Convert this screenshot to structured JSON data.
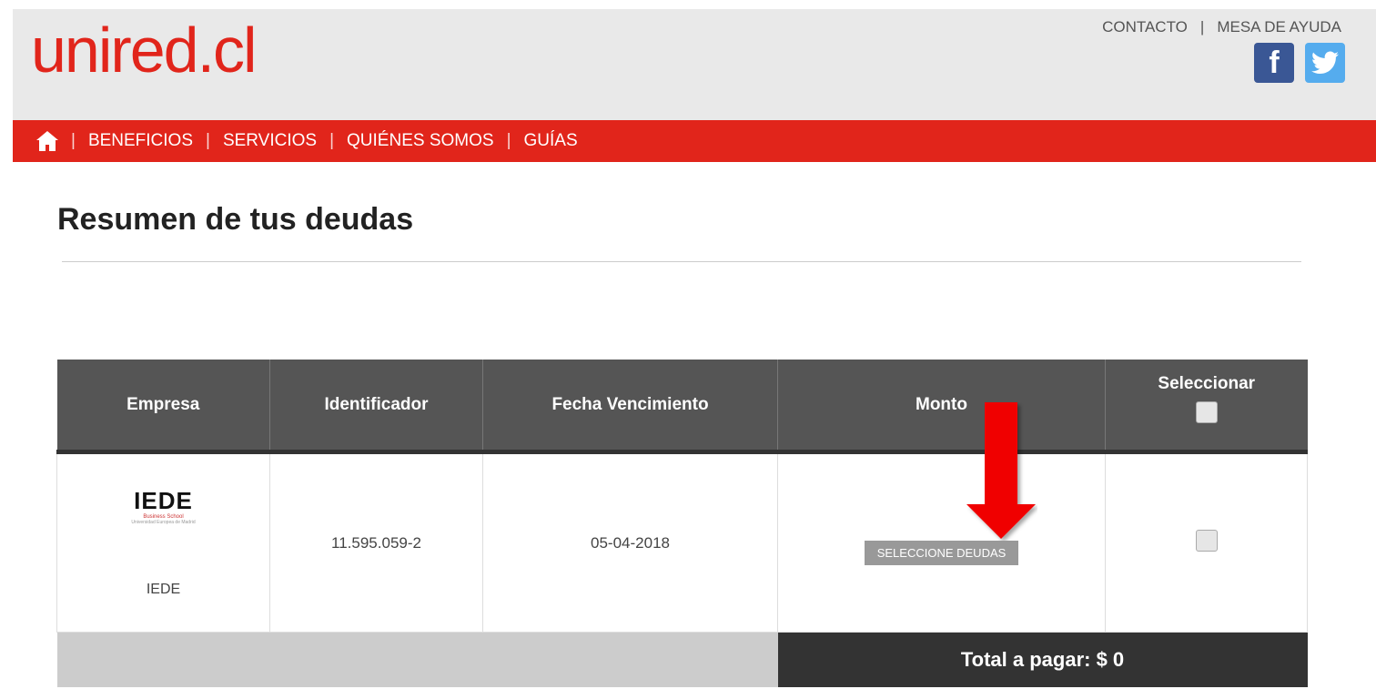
{
  "header": {
    "logo": "unired.cl",
    "links": [
      "CONTACTO",
      "MESA DE AYUDA"
    ],
    "social": [
      "facebook-icon",
      "twitter-icon"
    ]
  },
  "nav": {
    "items": [
      "BENEFICIOS",
      "SERVICIOS",
      "QUIÉNES SOMOS",
      "GUÍAS"
    ]
  },
  "page": {
    "title": "Resumen de tus deudas"
  },
  "table": {
    "headers": [
      "Empresa",
      "Identificador",
      "Fecha Vencimiento",
      "Monto",
      "Seleccionar"
    ],
    "row": {
      "logo_text": "IEDE",
      "logo_sub1": "Business School",
      "logo_sub2": "Universidad Europea de Madrid",
      "empresa": "IEDE",
      "identificador": "11.595.059-2",
      "fecha": "05-04-2018",
      "monto_button": "SELECCIONE DEUDAS"
    },
    "total": "Total a pagar: $ 0"
  },
  "colors": {
    "brand_red": "#e1251b",
    "header_gray": "#e9e9e9",
    "table_header": "#555555"
  }
}
